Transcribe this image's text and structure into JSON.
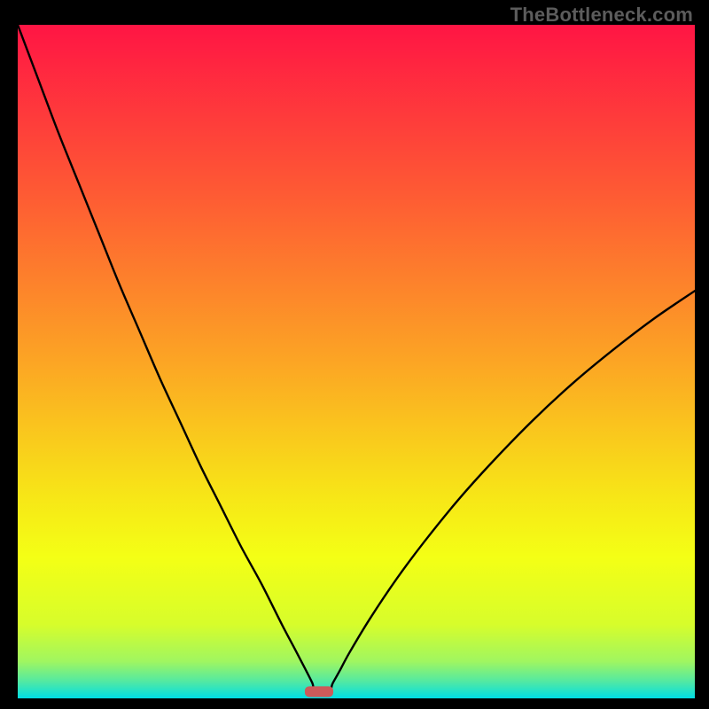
{
  "watermark": "TheBottleneck.com",
  "chart_data": {
    "type": "line",
    "title": "",
    "xlabel": "",
    "ylabel": "",
    "xlim": [
      0,
      100
    ],
    "ylim": [
      0,
      100
    ],
    "grid": false,
    "legend": false,
    "annotations": [],
    "background": {
      "type": "vertical-gradient",
      "stops": [
        {
          "pos": 0.0,
          "color": "#ff1544"
        },
        {
          "pos": 0.26,
          "color": "#fe5d33"
        },
        {
          "pos": 0.5,
          "color": "#fca524"
        },
        {
          "pos": 0.7,
          "color": "#f7e617"
        },
        {
          "pos": 0.79,
          "color": "#f4ff15"
        },
        {
          "pos": 0.89,
          "color": "#d7fd2b"
        },
        {
          "pos": 0.945,
          "color": "#a0f660"
        },
        {
          "pos": 0.975,
          "color": "#52e9a3"
        },
        {
          "pos": 1.0,
          "color": "#00dde5"
        }
      ]
    },
    "marker": {
      "x": 44.5,
      "y": 1.0,
      "color": "#cc5a5a",
      "shape": "rounded-rect",
      "w": 4.2,
      "h": 1.6
    },
    "series": [
      {
        "name": "bottleneck-curve",
        "color": "#000000",
        "x": [
          0,
          3,
          6,
          9,
          12,
          15,
          18,
          21,
          24,
          27,
          30,
          33,
          36,
          39,
          41,
          42.5,
          43.5,
          44,
          46,
          46.5,
          47.5,
          49,
          52,
          56,
          60,
          65,
          70,
          76,
          82,
          88,
          94,
          100
        ],
        "y": [
          100,
          92,
          84,
          76.5,
          69,
          61.5,
          54.5,
          47.5,
          41,
          34.5,
          28.5,
          22.5,
          17,
          11,
          7.2,
          4.3,
          2.3,
          1.0,
          1.0,
          2.2,
          4.0,
          6.8,
          11.8,
          17.8,
          23.2,
          29.4,
          35,
          41.2,
          46.8,
          51.8,
          56.4,
          60.5
        ]
      }
    ]
  }
}
